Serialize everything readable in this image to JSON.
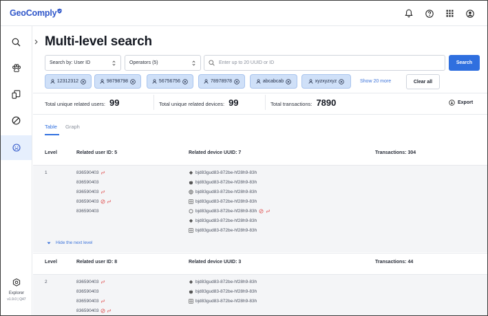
{
  "app": {
    "brand": "GeoComply",
    "version": "v1.9.0 | Q47",
    "explorer_label": "Explorer"
  },
  "header_icons": [
    "bell-icon",
    "help-icon",
    "apps-grid-icon",
    "account-icon"
  ],
  "sidebar": {
    "items": [
      {
        "name": "search-icon"
      },
      {
        "name": "paw-icon"
      },
      {
        "name": "devices-icon"
      },
      {
        "name": "blocked-icon"
      },
      {
        "name": "face-icon",
        "active": true
      }
    ]
  },
  "page": {
    "title": "Multi-level search"
  },
  "search": {
    "search_by_value": "Search by: User ID",
    "operators_value": "Operators (5)",
    "placeholder": "Enter up to 20 UUID or ID",
    "button_label": "Search"
  },
  "chips": [
    "12312312",
    "98798798",
    "56756756",
    "78978978",
    "abcabcab",
    "xyzxyzxyz"
  ],
  "show_more_label": "Show 20 more",
  "clear_all_label": "Clear all",
  "stats": {
    "users_label": "Total unique related users:",
    "users_value": "99",
    "devices_label": "Total unique related devices:",
    "devices_value": "99",
    "transactions_label": "Total transactions:",
    "transactions_value": "7890",
    "export_label": "Export"
  },
  "tabs": [
    {
      "label": "Table",
      "active": true
    },
    {
      "label": "Graph",
      "active": false
    }
  ],
  "columns": {
    "level": "Level",
    "user": "Related user ID: 5",
    "device": "Related device UUID: 7",
    "transactions": "Transactions: 304"
  },
  "level1": {
    "level": "1",
    "users": [
      {
        "id": "836590403",
        "flags": [
          "link"
        ]
      },
      {
        "id": "836590403",
        "flags": []
      },
      {
        "id": "836590403",
        "flags": [
          "link"
        ]
      },
      {
        "id": "836590403",
        "flags": [
          "block",
          "link"
        ]
      },
      {
        "id": "836590403",
        "flags": []
      }
    ],
    "devices": [
      {
        "id": "bjd83gud83-872be-hf28h9-83h",
        "os": "android",
        "flags": []
      },
      {
        "id": "bjd83gud83-872be-hf28h9-83h",
        "os": "apple",
        "flags": []
      },
      {
        "id": "bjd83gud83-872be-hf28h9-83h",
        "os": "web",
        "flags": []
      },
      {
        "id": "bjd83gud83-872be-hf28h9-83h",
        "os": "window",
        "flags": []
      },
      {
        "id": "bjd83gud83-872be-hf28h9-83h",
        "os": "mobile",
        "flags": [
          "block",
          "link"
        ]
      },
      {
        "id": "bjd83gud83-872be-hf28h9-83h",
        "os": "android",
        "flags": []
      },
      {
        "id": "bjd83gud83-872be-hf28h9-83h",
        "os": "window",
        "flags": []
      }
    ],
    "hide_label": "Hide the next level"
  },
  "level2": {
    "columns": {
      "level": "Level",
      "user": "Related user ID: 8",
      "device": "Related device UUID: 3",
      "transactions": "Transactions: 44"
    },
    "level": "2",
    "users": [
      {
        "id": "836590403",
        "flags": [
          "link"
        ]
      },
      {
        "id": "836590403",
        "flags": []
      },
      {
        "id": "836590403",
        "flags": [
          "link"
        ]
      },
      {
        "id": "836590403",
        "flags": [
          "block",
          "link"
        ]
      }
    ],
    "devices": [
      {
        "id": "bjd83gud83-872be-hf28h9-83h",
        "os": "android",
        "flags": []
      },
      {
        "id": "bjd83gud83-872be-hf28h9-83h",
        "os": "apple",
        "flags": []
      },
      {
        "id": "bjd83gud83-872be-hf28h9-83h",
        "os": "window",
        "flags": []
      }
    ]
  },
  "colors": {
    "accent": "#2f6fdf",
    "chip_bg": "#cfe0f8",
    "flag_red": "#e05656",
    "active_side": "#e6effd"
  }
}
